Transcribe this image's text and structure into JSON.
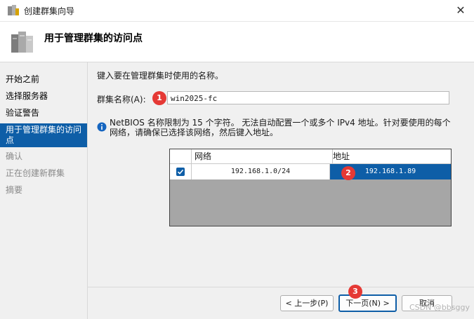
{
  "window": {
    "title": "创建群集向导",
    "close_glyph": "✕"
  },
  "header": {
    "title": "用于管理群集的访问点"
  },
  "sidebar": {
    "items": [
      {
        "label": "开始之前",
        "state": "done"
      },
      {
        "label": "选择服务器",
        "state": "done"
      },
      {
        "label": "验证警告",
        "state": "done"
      },
      {
        "label": "用于管理群集的访问点",
        "state": "active"
      },
      {
        "label": "确认",
        "state": "pending"
      },
      {
        "label": "正在创建新群集",
        "state": "pending"
      },
      {
        "label": "摘要",
        "state": "pending"
      }
    ]
  },
  "main": {
    "instruction": "键入要在管理群集时使用的名称。",
    "name_label": "群集名称(A):",
    "name_value": "win2025-fc",
    "info_text": "NetBIOS 名称限制为 15 个字符。 无法自动配置一个或多个 IPv4 地址。针对要使用的每个网络，请确保已选择该网络，然后键入地址。",
    "table": {
      "columns": [
        "网络",
        "地址"
      ],
      "rows": [
        {
          "checked": true,
          "network": "192.168.1.0/24",
          "address": "192.168.1.89"
        }
      ]
    }
  },
  "markers": [
    "1",
    "2",
    "3"
  ],
  "footer": {
    "prev_label": "< 上一步(P)",
    "next_label": "下一页(N) >",
    "cancel_label": "取消"
  },
  "watermark": "CSDN @bbsggy",
  "colors": {
    "accent": "#0e5ea7",
    "marker": "#e53935"
  }
}
